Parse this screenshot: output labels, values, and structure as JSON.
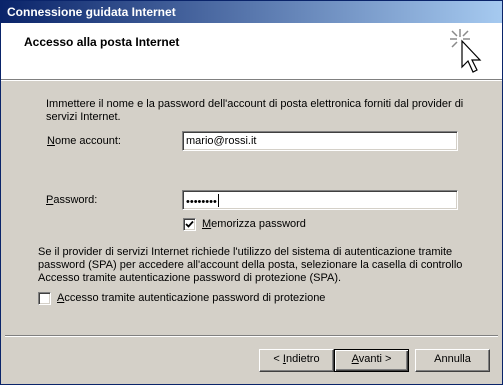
{
  "window": {
    "title": "Connessione guidata Internet"
  },
  "header": {
    "title": "Accesso alla posta Internet",
    "icon": "wizard-cursor-sparkle-icon"
  },
  "main": {
    "intro": "Immettere il nome e la password dell'account di posta elettronica forniti dal provider di servizi Internet.",
    "account_label_mnemonic": "N",
    "account_label_rest": "ome account:",
    "account_value": "mario@rossi.it",
    "password_label_mnemonic": "P",
    "password_label_rest": "assword:",
    "password_value": "••••••••",
    "remember_mnemonic": "M",
    "remember_rest": "emorizza password",
    "remember_checked": true,
    "spa_text": "Se il provider di servizi Internet richiede l'utilizzo del sistema di autenticazione tramite password (SPA) per accedere all'account della posta, selezionare la casella di controllo Accesso tramite autenticazione password di protezione (SPA).",
    "spa_mnemonic": "A",
    "spa_rest": "ccesso tramite autenticazione password di protezione",
    "spa_checked": false
  },
  "footer": {
    "back_prefix": "< ",
    "back_mnemonic": "I",
    "back_rest": "ndietro",
    "next_mnemonic": "A",
    "next_rest": "vanti >",
    "cancel_label": "Annulla"
  }
}
